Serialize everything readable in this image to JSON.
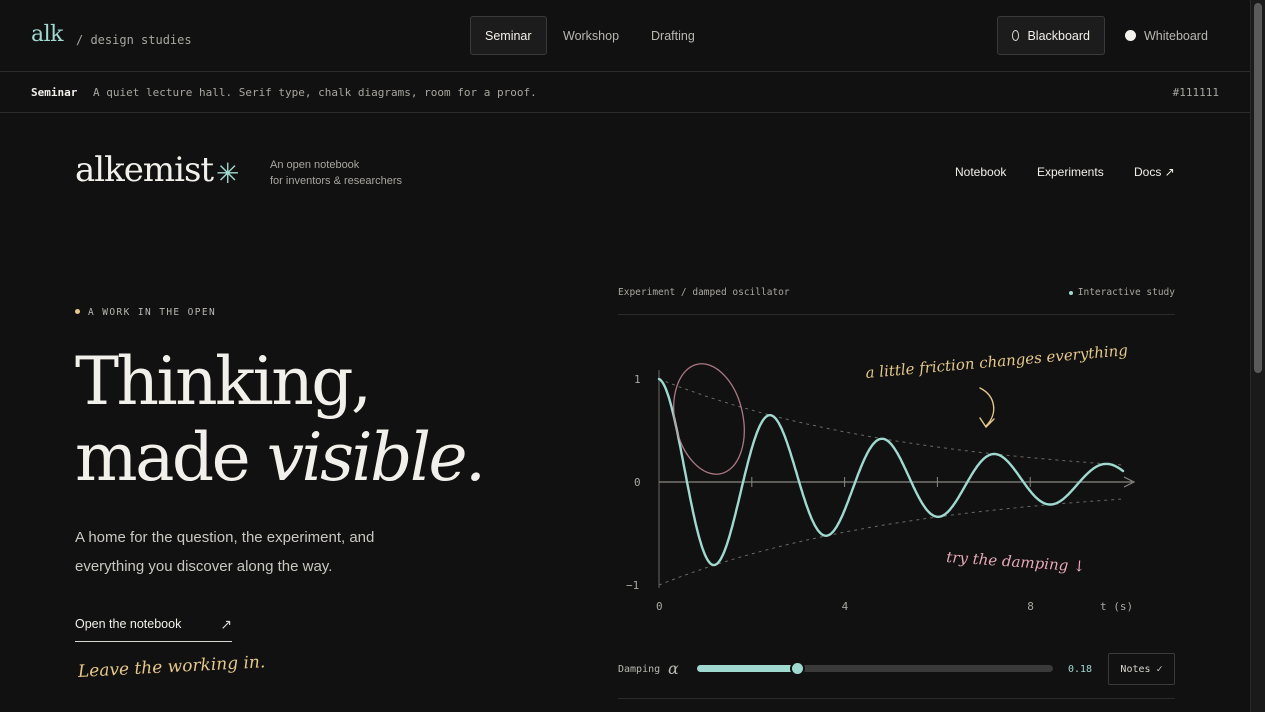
{
  "studies_bar": {
    "logo": "alk",
    "subtitle": "/ design studies",
    "modes": [
      "Seminar",
      "Workshop",
      "Drafting"
    ],
    "active_mode": "Seminar",
    "themes": [
      {
        "label": "Blackboard",
        "selected": true
      },
      {
        "label": "Whiteboard",
        "selected": false
      }
    ]
  },
  "info_strip": {
    "name": "Seminar",
    "description": "A quiet lecture hall. Serif type, chalk diagrams, room for a proof.",
    "hex": "#111111"
  },
  "site": {
    "brand": "alkemist",
    "brand_mark_icon": "asterisk-icon",
    "tagline_line1": "An open notebook",
    "tagline_line2": "for inventors & researchers",
    "nav": [
      "Notebook",
      "Experiments",
      "Docs ↗"
    ]
  },
  "hero": {
    "eyebrow": "A WORK IN THE OPEN",
    "headline_line1": "Thinking,",
    "headline_line2_plain": "made ",
    "headline_line2_italic": "visible.",
    "lede": "A home for the question, the experiment, and everything you discover along the way.",
    "cta_label": "Open the notebook",
    "cta_icon": "arrow-up-right-icon",
    "handnote": "Leave the working in."
  },
  "experiment": {
    "path": "Experiment / damped oscillator",
    "badge": "Interactive study",
    "annotation_top": "a little friction changes everything",
    "annotation_bottom": "try the damping ↓",
    "damping_label": "Damping",
    "damping_symbol": "α",
    "damping_value": "0.18",
    "damping_fraction": 0.28,
    "notes_label": "Notes",
    "notes_icon": "check-icon"
  },
  "chart_data": {
    "type": "line",
    "function": "exp(-0.18 t) cos(2.6 t)",
    "xlabel": "t (s)",
    "x_ticks": [
      "0",
      "4",
      "8"
    ],
    "y_ticks": [
      "1",
      "0",
      "−1"
    ],
    "xlim": [
      0,
      10
    ],
    "ylim": [
      -1,
      1
    ],
    "envelope": "dashed ±exp(-0.18 t)",
    "series": [
      {
        "damping": 0.18,
        "omega": 2.6,
        "color": "#9fd9cf"
      }
    ]
  },
  "colors": {
    "background": "#111111",
    "accent": "#9fd9cf",
    "chalk_yellow": "#e6c887",
    "chalk_pink": "#e8a8b8"
  }
}
